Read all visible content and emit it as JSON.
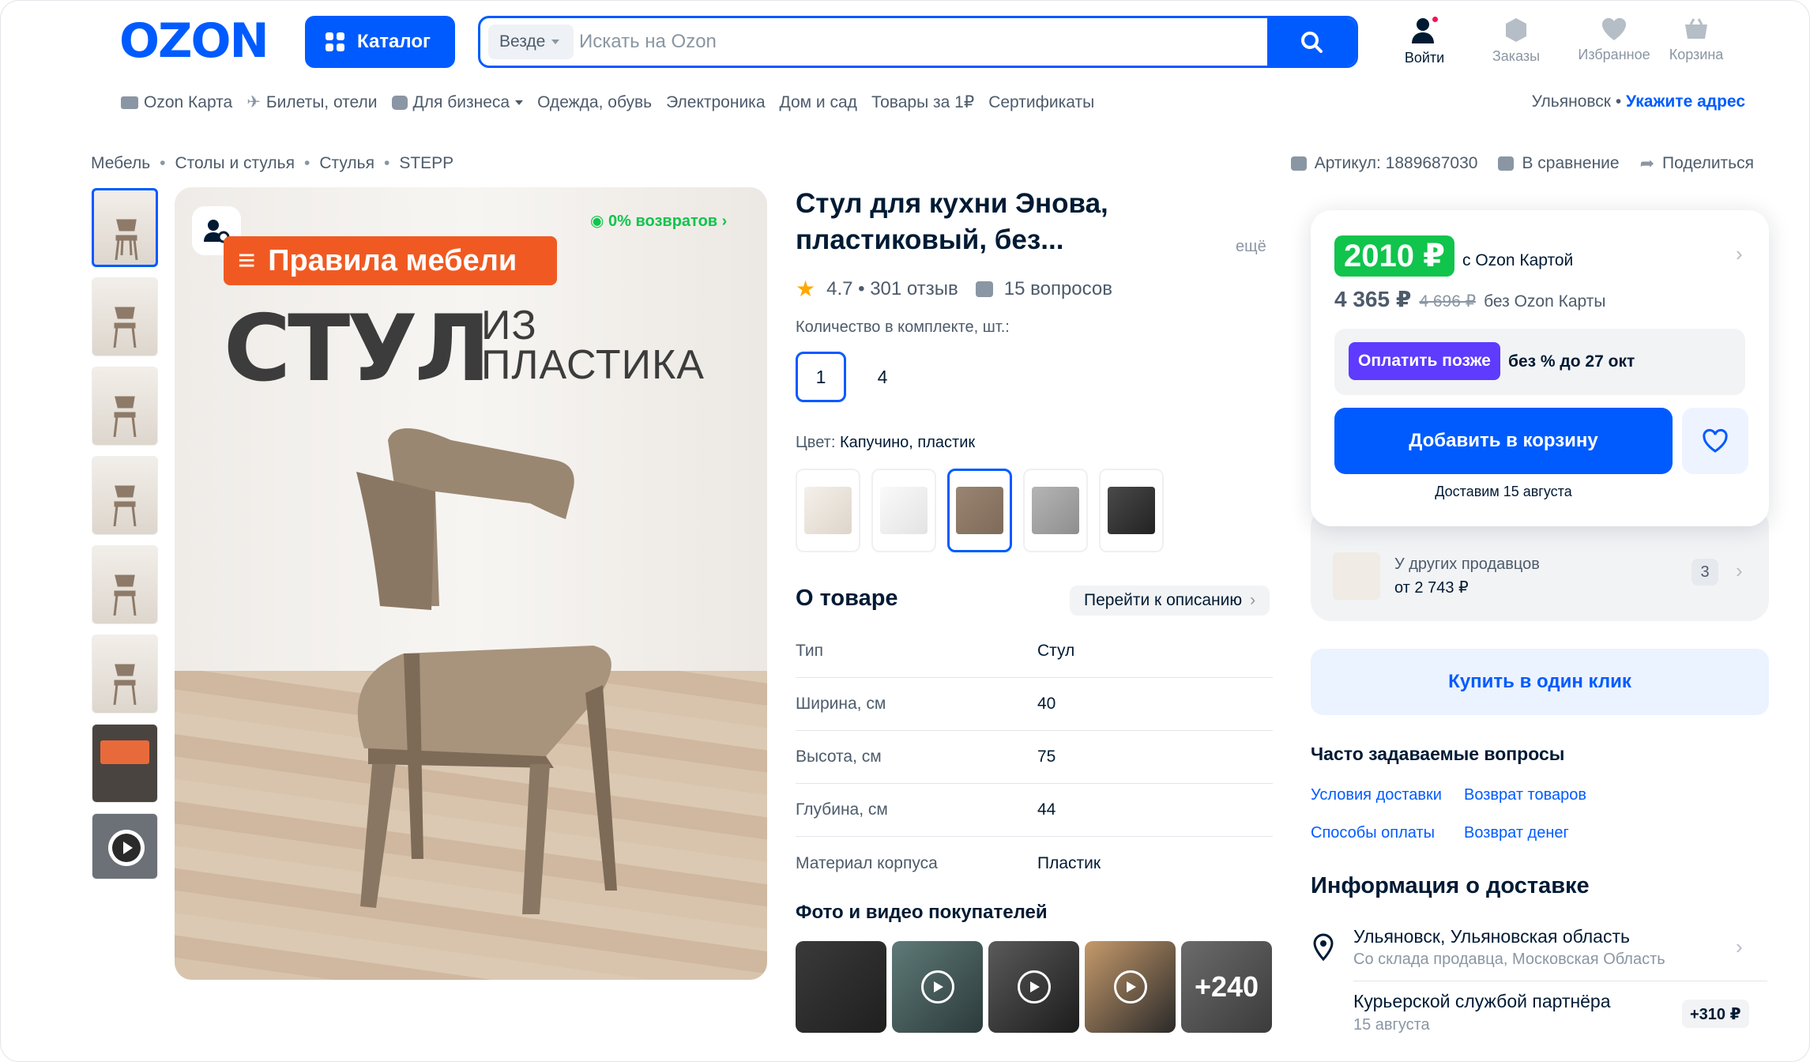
{
  "header": {
    "logo": "OZON",
    "catalog_label": "Каталог",
    "search_scope": "Везде",
    "search_placeholder": "Искать на Ozon",
    "icons": [
      {
        "name": "login",
        "label": "Войти",
        "icon": "user-icon"
      },
      {
        "name": "orders",
        "label": "Заказы",
        "icon": "box-icon"
      },
      {
        "name": "favorites",
        "label": "Избранное",
        "icon": "heart-icon"
      },
      {
        "name": "cart",
        "label": "Корзина",
        "icon": "basket-icon"
      }
    ]
  },
  "nav": {
    "items": [
      "Ozon Карта",
      "Билеты, отели",
      "Для бизнеса",
      "Одежда, обувь",
      "Электроника",
      "Дом и сад",
      "Товары за 1₽",
      "Сертификаты"
    ],
    "city": "Ульяновск",
    "address_link": "Укажите адрес"
  },
  "breadcrumbs": [
    "Мебель",
    "Столы и стулья",
    "Стулья",
    "STEPP"
  ],
  "product_actions": {
    "article": "Артикул: 1889687030",
    "compare": "В сравнение",
    "share": "Поделиться"
  },
  "gallery": {
    "returns": "0% возвратов",
    "banner": "Правила мебели",
    "headline_big": "СТУЛ",
    "headline_small_1": "ИЗ",
    "headline_small_2": "ПЛАСТИКА"
  },
  "product": {
    "title": "Стул для кухни Энова, пластиковый, без...",
    "more": "ещё",
    "rating": "4.7 • 301 отзыв",
    "questions": "15 вопросов",
    "qty_label": "Количество в комплекте, шт.:",
    "qty_options": [
      "1",
      "4"
    ],
    "color_label": "Цвет:",
    "color_value": "Капучино, пластик",
    "swatches": [
      "#ece6df",
      "#f1f1f1",
      "#8e7a68",
      "#a3a3a3",
      "#2f2f2f"
    ],
    "about_title": "О товаре",
    "to_description": "Перейти к описанию",
    "specs": [
      {
        "k": "Тип",
        "v": "Стул"
      },
      {
        "k": "Ширина, см",
        "v": "40"
      },
      {
        "k": "Высота, см",
        "v": "75"
      },
      {
        "k": "Глубина, см",
        "v": "44"
      },
      {
        "k": "Материал корпуса",
        "v": "Пластик"
      }
    ],
    "photos_title": "Фото и видео покупателей",
    "photos_more": "+240"
  },
  "price": {
    "card_price": "2010 ₽",
    "card_label": "с Ozon Картой",
    "price": "4 365 ₽",
    "old_price": "4 696 ₽",
    "no_card_label": "без Ozon Карты",
    "pay_later_btn": "Оплатить позже",
    "pay_later_text": "без % до 27 окт",
    "add_to_cart": "Добавить в корзину",
    "delivery": "Доставим 15 августа"
  },
  "sellers": {
    "label": "У других продавцов",
    "from": "от 2 743 ₽",
    "count": "3"
  },
  "one_click": "Купить в один клик",
  "faq": {
    "title": "Часто задаваемые вопросы",
    "links": [
      "Условия доставки",
      "Возврат товаров",
      "Способы оплаты",
      "Возврат денег"
    ]
  },
  "delivery_info": {
    "title": "Информация о доставке",
    "city": "Ульяновск, Ульяновская область",
    "warehouse": "Со склада продавца, Московская Область",
    "courier": "Курьерской службой партнёра",
    "courier_date": "15 августа",
    "courier_price": "+310 ₽"
  },
  "colors": {
    "accent": "#005bff",
    "green": "#10c44c",
    "text": "#001a34",
    "muted": "#4d5b6b"
  }
}
